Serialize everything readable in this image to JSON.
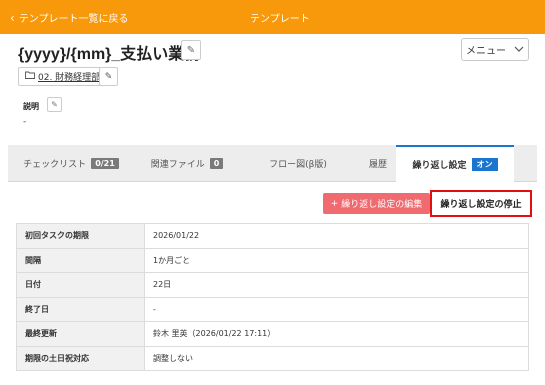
{
  "topbar": {
    "back_label": "テンプレート一覧に戻る",
    "title": "テンプレート"
  },
  "header": {
    "page_title": "{yyyy}/{mm}_支払い業務",
    "menu_label": "メニュー"
  },
  "folder": {
    "label": "02. 財務経理部"
  },
  "description": {
    "label": "説明",
    "value": "-"
  },
  "tabs": [
    {
      "label": "チェックリスト",
      "badge": "0/21"
    },
    {
      "label": "関連ファイル",
      "badge": "0"
    },
    {
      "label": "フロー図(β版)",
      "badge": ""
    },
    {
      "label": "履歴",
      "badge": ""
    },
    {
      "label": "繰り返し設定",
      "badge": "オン",
      "active": true
    }
  ],
  "actions": {
    "edit_label": "繰り返し設定の編集",
    "stop_label": "繰り返し設定の停止"
  },
  "settings": [
    {
      "key": "初回タスクの期限",
      "value": "2026/01/22"
    },
    {
      "key": "間隔",
      "value": "1か月ごと"
    },
    {
      "key": "日付",
      "value": "22日"
    },
    {
      "key": "終了日",
      "value": "-"
    },
    {
      "key": "最終更新",
      "value": "鈴木 里英（2026/01/22 17:11）"
    },
    {
      "key": "期限の土日祝対応",
      "value": "調整しない"
    }
  ],
  "colors": {
    "topbar": "#f8990c",
    "accent_blue": "#1a75cf",
    "edit_button": "#ef6b6f",
    "highlight_border": "#e01010"
  }
}
